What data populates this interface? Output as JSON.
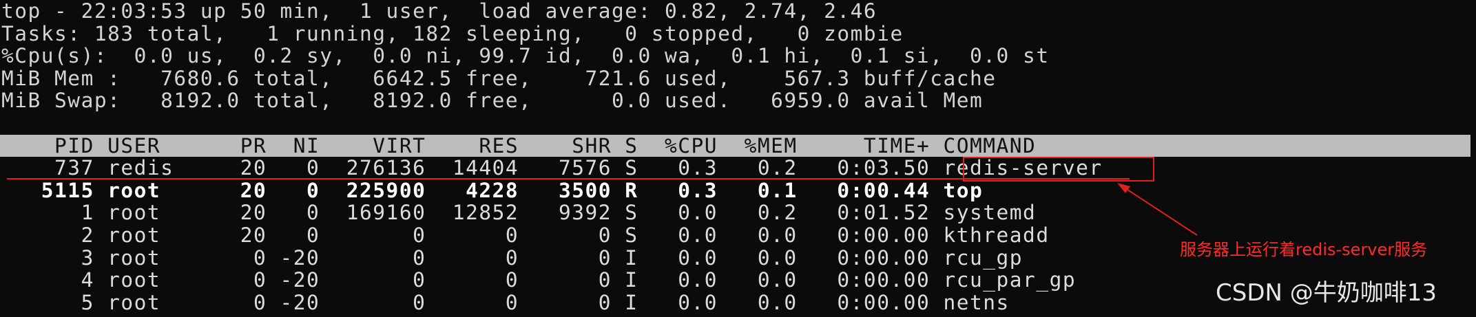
{
  "summary": {
    "line1": "top - 22:03:53 up 50 min,  1 user,  load average: 0.82, 2.74, 2.46",
    "line2": "Tasks: 183 total,   1 running, 182 sleeping,   0 stopped,   0 zombie",
    "line3": "%Cpu(s):  0.0 us,  0.2 sy,  0.0 ni, 99.7 id,  0.0 wa,  0.1 hi,  0.1 si,  0.0 st",
    "line4": "MiB Mem :   7680.6 total,   6642.5 free,    721.6 used,    567.3 buff/cache",
    "line5": "MiB Swap:   8192.0 total,   8192.0 free,      0.0 used.   6959.0 avail Mem"
  },
  "columns": [
    "PID",
    "USER",
    "PR",
    "NI",
    "VIRT",
    "RES",
    "SHR",
    "S",
    "%CPU",
    "%MEM",
    "TIME+",
    "COMMAND"
  ],
  "header_line": "    PID USER      PR  NI    VIRT    RES    SHR S  %CPU  %MEM     TIME+ COMMAND",
  "processes": [
    {
      "pid": "737",
      "user": "redis",
      "pr": "20",
      "ni": "0",
      "virt": "276136",
      "res": "14404",
      "shr": "7576",
      "s": "S",
      "cpu": "0.3",
      "mem": "0.2",
      "time": "0:03.50",
      "command": "redis-server",
      "text": "    737 redis     20   0  276136  14404   7576 S   0.3   0.2   0:03.50 redis-server"
    },
    {
      "pid": "5115",
      "user": "root",
      "pr": "20",
      "ni": "0",
      "virt": "225900",
      "res": "4228",
      "shr": "3500",
      "s": "R",
      "cpu": "0.3",
      "mem": "0.1",
      "time": "0:00.44",
      "command": "top",
      "text": "   5115 root      20   0  225900   4228   3500 R   0.3   0.1   0:00.44 top"
    },
    {
      "pid": "1",
      "user": "root",
      "pr": "20",
      "ni": "0",
      "virt": "169160",
      "res": "12852",
      "shr": "9392",
      "s": "S",
      "cpu": "0.0",
      "mem": "0.2",
      "time": "0:01.52",
      "command": "systemd",
      "text": "      1 root      20   0  169160  12852   9392 S   0.0   0.2   0:01.52 systemd"
    },
    {
      "pid": "2",
      "user": "root",
      "pr": "20",
      "ni": "0",
      "virt": "0",
      "res": "0",
      "shr": "0",
      "s": "S",
      "cpu": "0.0",
      "mem": "0.0",
      "time": "0:00.00",
      "command": "kthreadd",
      "text": "      2 root      20   0       0      0      0 S   0.0   0.0   0:00.00 kthreadd"
    },
    {
      "pid": "3",
      "user": "root",
      "pr": "0",
      "ni": "-20",
      "virt": "0",
      "res": "0",
      "shr": "0",
      "s": "I",
      "cpu": "0.0",
      "mem": "0.0",
      "time": "0:00.00",
      "command": "rcu_gp",
      "text": "      3 root       0 -20       0      0      0 I   0.0   0.0   0:00.00 rcu_gp"
    },
    {
      "pid": "4",
      "user": "root",
      "pr": "0",
      "ni": "-20",
      "virt": "0",
      "res": "0",
      "shr": "0",
      "s": "I",
      "cpu": "0.0",
      "mem": "0.0",
      "time": "0:00.00",
      "command": "rcu_par_gp",
      "text": "      4 root       0 -20       0      0      0 I   0.0   0.0   0:00.00 rcu_par_gp"
    },
    {
      "pid": "5",
      "user": "root",
      "pr": "0",
      "ni": "-20",
      "virt": "0",
      "res": "0",
      "shr": "0",
      "s": "I",
      "cpu": "0.0",
      "mem": "0.0",
      "time": "0:00.00",
      "command": "netns",
      "text": "      5 root       0 -20       0      0      0 I   0.0   0.0   0:00.00 netns"
    }
  ],
  "annotation": {
    "text": "服务器上运行着redis-server服务",
    "color": "#e0201c"
  },
  "watermark": "CSDN @牛奶咖啡13",
  "colors": {
    "background": "#0b0b0b",
    "header_bg": "#bdbdbd",
    "annotation_red": "#e0201c"
  }
}
